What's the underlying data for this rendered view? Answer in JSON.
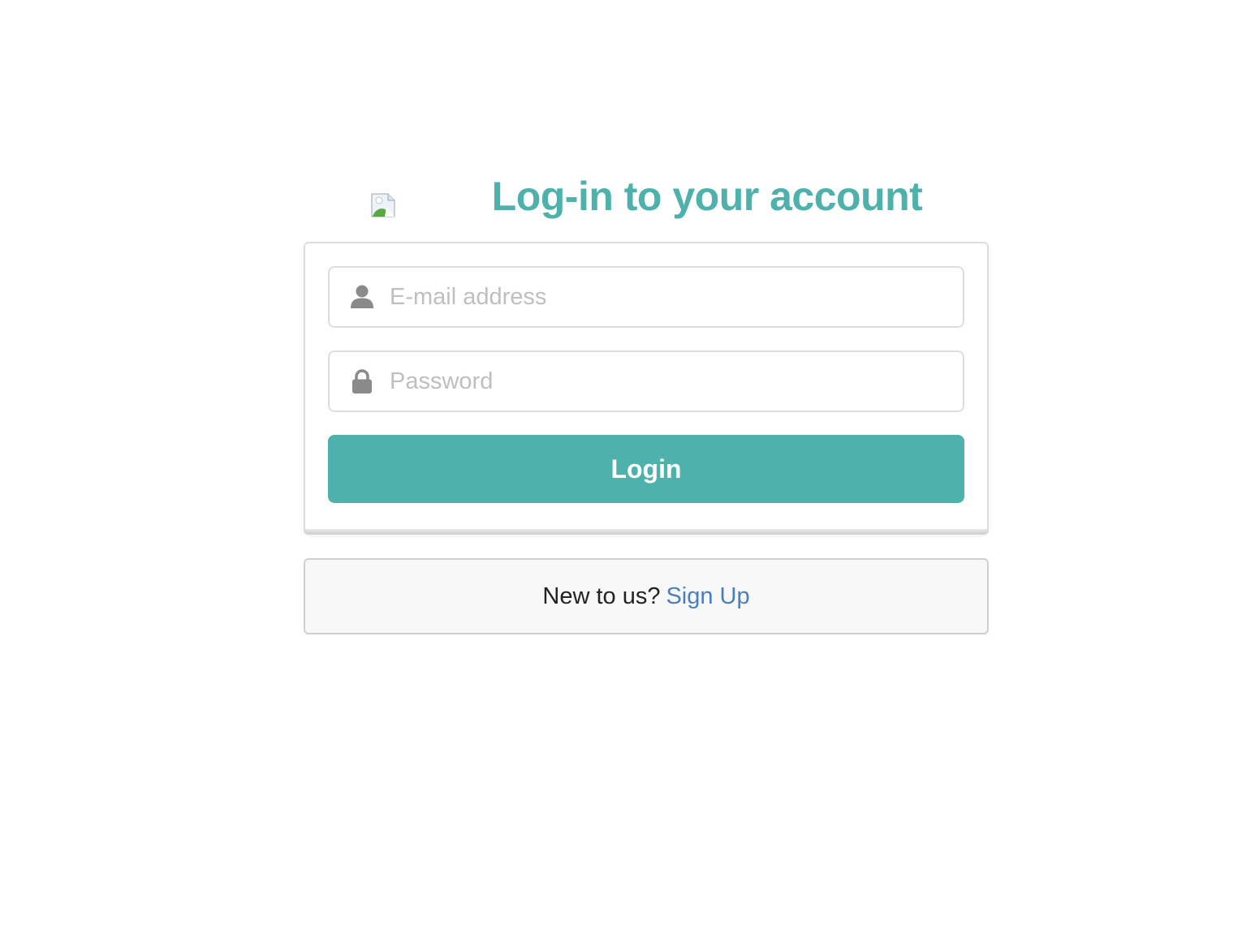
{
  "header": {
    "title": "Log-in to your account",
    "logo_icon": "broken-image-icon"
  },
  "form": {
    "email": {
      "placeholder": "E-mail address",
      "value": "",
      "icon": "user-icon"
    },
    "password": {
      "placeholder": "Password",
      "value": "",
      "icon": "lock-icon"
    },
    "login_label": "Login"
  },
  "signup": {
    "prompt": "New to us?",
    "link_label": "Sign Up"
  },
  "colors": {
    "accent": "#4fb1ab",
    "link": "#4a7fbf",
    "icon": "#8a8a8a",
    "placeholder": "#bfbfbf"
  }
}
